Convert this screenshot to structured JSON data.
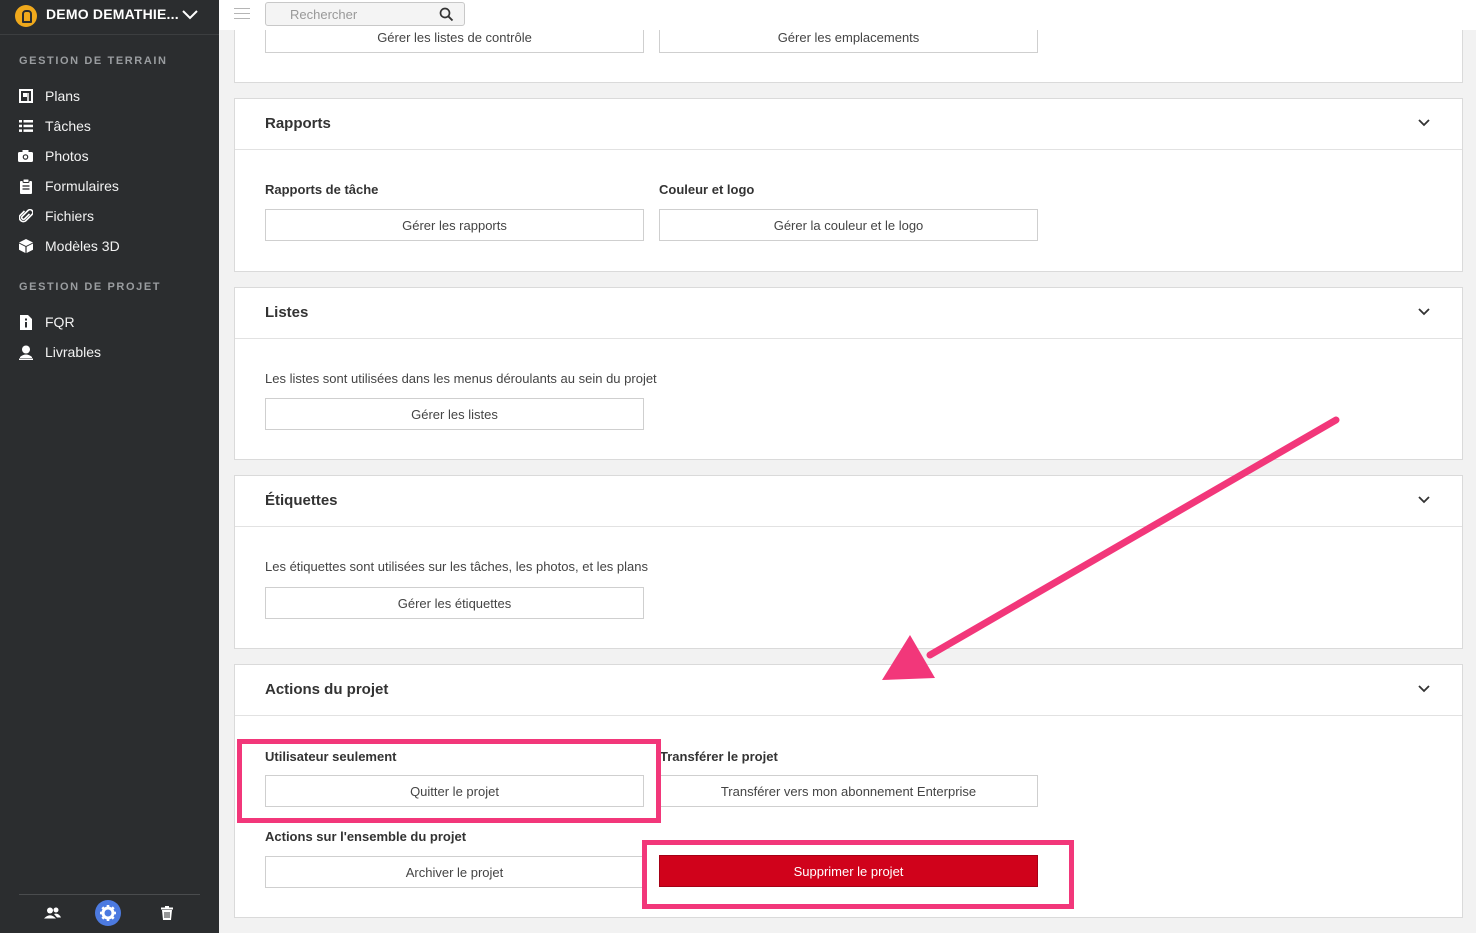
{
  "project": {
    "name": "DEMO DEMATHIE..."
  },
  "search": {
    "placeholder": "Rechercher"
  },
  "sidebar": {
    "section1": "GESTION DE TERRAIN",
    "items1": [
      {
        "label": "Plans",
        "icon": "plans-icon"
      },
      {
        "label": "Tâches",
        "icon": "list-icon"
      },
      {
        "label": "Photos",
        "icon": "camera-icon"
      },
      {
        "label": "Formulaires",
        "icon": "clipboard-icon"
      },
      {
        "label": "Fichiers",
        "icon": "paperclip-icon"
      },
      {
        "label": "Modèles 3D",
        "icon": "cube-icon"
      }
    ],
    "section2": "GESTION DE PROJET",
    "items2": [
      {
        "label": "FQR",
        "icon": "document-info-icon"
      },
      {
        "label": "Livrables",
        "icon": "user-icon"
      }
    ],
    "footer": [
      {
        "icon": "users-icon",
        "active": false
      },
      {
        "icon": "gear-icon",
        "active": true
      },
      {
        "icon": "trash-icon",
        "active": false
      }
    ]
  },
  "top_card": {
    "btn_left": "Gérer les listes de contrôle",
    "btn_right": "Gérer les emplacements"
  },
  "rapports": {
    "title": "Rapports",
    "left_label": "Rapports de tâche",
    "left_button": "Gérer les rapports",
    "right_label": "Couleur et logo",
    "right_button": "Gérer la couleur et le logo"
  },
  "listes": {
    "title": "Listes",
    "description": "Les listes sont utilisées dans les menus déroulants au sein du projet",
    "button": "Gérer les listes"
  },
  "etiquettes": {
    "title": "Étiquettes",
    "description": "Les étiquettes sont utilisées sur les tâches, les photos, et les plans",
    "button": "Gérer les étiquettes"
  },
  "actions": {
    "title": "Actions du projet",
    "user_label": "Utilisateur seulement",
    "quit_button": "Quitter le projet",
    "transfer_label": "Transférer le projet",
    "transfer_button": "Transférer vers mon abonnement Enterprise",
    "whole_label": "Actions sur l'ensemble du projet",
    "archive_button": "Archiver le projet",
    "delete_button": "Supprimer le projet"
  },
  "colors": {
    "sidebar_bg": "#2b2d2f",
    "danger": "#d0021b",
    "highlight": "#f2377a",
    "accent": "#4c7ae0"
  }
}
